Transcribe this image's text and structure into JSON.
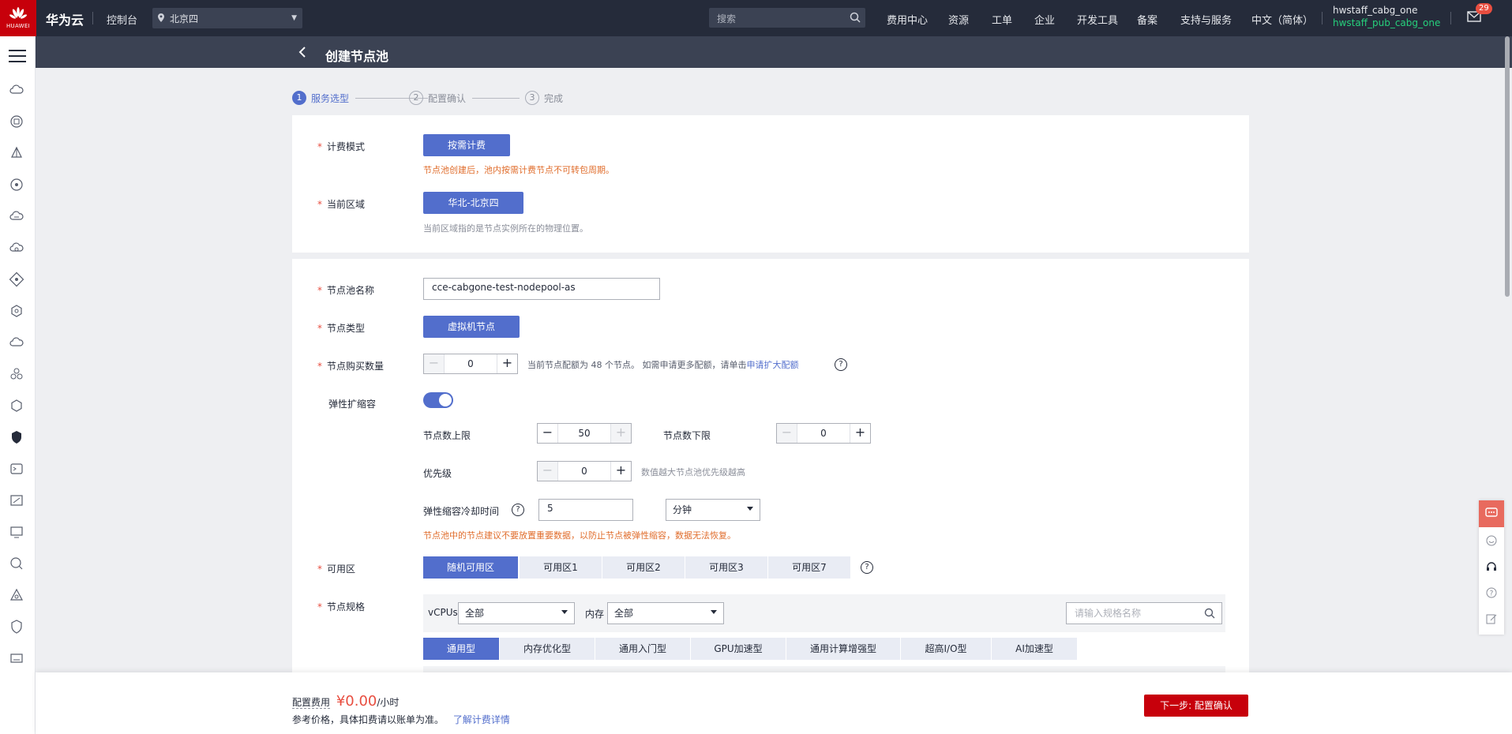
{
  "topbar": {
    "logo_text": "HUAWEI",
    "brand": "华为云",
    "console": "控制台",
    "region": "北京四",
    "search_placeholder": "搜索",
    "nav": [
      "费用中心",
      "资源",
      "工单",
      "企业",
      "开发工具",
      "备案",
      "支持与服务",
      "中文（简体）"
    ],
    "user_name": "hwstaff_cabg_one",
    "user_account": "hwstaff_pub_cabg_one",
    "mail_count": "29"
  },
  "page": {
    "title": "创建节点池"
  },
  "steps": [
    {
      "num": "1",
      "label": "服务选型"
    },
    {
      "num": "2",
      "label": "配置确认"
    },
    {
      "num": "3",
      "label": "完成"
    }
  ],
  "billing": {
    "label": "计费模式",
    "button": "按需计费",
    "hint": "节点池创建后，池内按需计费节点不可转包周期。"
  },
  "region_field": {
    "label": "当前区域",
    "button": "华北-北京四",
    "hint": "当前区域指的是节点实例所在的物理位置。"
  },
  "nodepool_name": {
    "label": "节点池名称",
    "value": "cce-cabgone-test-nodepool-as"
  },
  "node_type": {
    "label": "节点类型",
    "button": "虚拟机节点"
  },
  "quantity": {
    "label": "节点购买数量",
    "value": "0",
    "hint": "当前节点配额为 48 个节点。 如需申请更多配额，请单击",
    "link": "申请扩大配额"
  },
  "autoscale": {
    "label": "弹性扩缩容",
    "enabled": true,
    "max_label": "节点数上限",
    "max_value": "50",
    "min_label": "节点数下限",
    "min_value": "0",
    "priority_label": "优先级",
    "priority_value": "0",
    "priority_hint": "数值越大节点池优先级越高",
    "cooldown_label": "弹性缩容冷却时间",
    "cooldown_value": "5",
    "cooldown_unit": "分钟",
    "warning": "节点池中的节点建议不要放置重要数据，以防止节点被弹性缩容，数据无法恢复。"
  },
  "az": {
    "label": "可用区",
    "options": [
      "随机可用区",
      "可用区1",
      "可用区2",
      "可用区3",
      "可用区7"
    ],
    "selected": "随机可用区"
  },
  "spec": {
    "label": "节点规格",
    "vcpu_label": "vCPUs",
    "vcpu_value": "全部",
    "mem_label": "内存",
    "mem_value": "全部",
    "search_placeholder": "请输入规格名称",
    "tabs": [
      "通用型",
      "内存优化型",
      "通用入门型",
      "GPU加速型",
      "通用计算增强型",
      "超高I/O型",
      "AI加速型"
    ],
    "selected_tab": "通用型"
  },
  "footer": {
    "fee_label": "配置费用",
    "fee_value": "¥0.00",
    "fee_unit": "/小时",
    "note": "参考价格，具体扣费请以账单为准。",
    "note_link": "了解计费详情",
    "next_button": "下一步: 配置确认"
  },
  "colors": {
    "accent": "#526ecc",
    "brand": "#c7000b",
    "topbar": "#252b3a",
    "warning": "#e06d2c"
  }
}
